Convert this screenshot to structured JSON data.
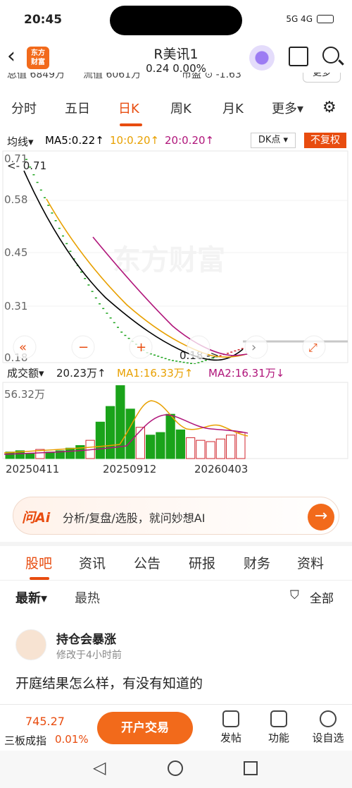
{
  "status": {
    "time": "20:45",
    "icons": "5G 4G"
  },
  "header": {
    "logo": "东方\n财富",
    "title": "R美讯1",
    "subtitle": "0.24  0.00%",
    "cut_row_items": [
      "总值 6849万",
      "流值 6061万",
      "市盈 ⊙ -1.63"
    ],
    "cut_button": "更多"
  },
  "tabs": [
    "分时",
    "五日",
    "日K",
    "周K",
    "月K",
    "更多▾"
  ],
  "active_tab": "日K",
  "ma_row": {
    "selector": "均线▾",
    "ma5": "MA5:0.22↑",
    "ma10": "10:0.20↑",
    "ma20": "20:0.20↑",
    "dk": "DK点 ▾",
    "fq": "不复权"
  },
  "chart_main_labels": {
    "y_ticks": [
      "0.71",
      "0.58",
      "0.45",
      "0.31",
      "0.18"
    ],
    "max_label": "0.71",
    "min_label": "0.18",
    "watermark": "东方财富"
  },
  "volume_row": {
    "title": "成交额▾",
    "value": "20.23万↑",
    "ma1": "MA1:16.33万↑",
    "ma2": "MA2:16.31万↓"
  },
  "volume_chart": {
    "max_label": "56.32万",
    "dates": [
      "20250411",
      "20250912",
      "20260403"
    ]
  },
  "chart_data": {
    "type": "line",
    "x_labels": [
      "20250411",
      "20250912",
      "20260403"
    ],
    "ylim": [
      0.18,
      0.71
    ],
    "series": [
      {
        "name": "MA5",
        "values": [
          0.71,
          0.58,
          0.45,
          0.34,
          0.26,
          0.21,
          0.19,
          0.18,
          0.2,
          0.22
        ]
      },
      {
        "name": "10",
        "values": [
          0.62,
          0.53,
          0.43,
          0.33,
          0.26,
          0.21,
          0.19,
          0.19,
          0.2,
          0.2
        ]
      },
      {
        "name": "20",
        "values": [
          0.48,
          0.42,
          0.36,
          0.3,
          0.25,
          0.21,
          0.19,
          0.19,
          0.2,
          0.2
        ]
      }
    ],
    "volume": {
      "values": [
        5,
        6,
        4,
        7,
        5,
        6,
        8,
        10,
        14,
        28,
        40,
        56,
        38,
        24,
        18,
        20,
        34,
        22,
        16,
        14,
        13,
        15,
        18,
        20
      ],
      "ylim": [
        0,
        56.32
      ]
    }
  },
  "ai_bar": {
    "logo": "问Ai",
    "text": "分析/复盘/选股，就问妙想AI",
    "arrow": "→"
  },
  "news_tabs": [
    "股吧",
    "资讯",
    "公告",
    "研报",
    "财务",
    "资料"
  ],
  "active_news_tab": "股吧",
  "sort": {
    "latest": "最新▾",
    "hot": "最热",
    "filter": "全部"
  },
  "post": {
    "user": "持仓会暴涨",
    "time": "修改于4小时前",
    "text": "开庭结果怎么样，有没有知道的"
  },
  "bottom": {
    "index_value": "745.27",
    "index_name": "三板成指",
    "index_pct": "0.01%",
    "open_button": "开户交易",
    "items": [
      "发帖",
      "功能",
      "设自选"
    ]
  },
  "colors": {
    "accent": "#e84c0f",
    "ma5": "#000000",
    "ma10": "#e8a000",
    "ma20": "#b0157a",
    "up": "#d0262d",
    "down": "#1aa31a"
  }
}
